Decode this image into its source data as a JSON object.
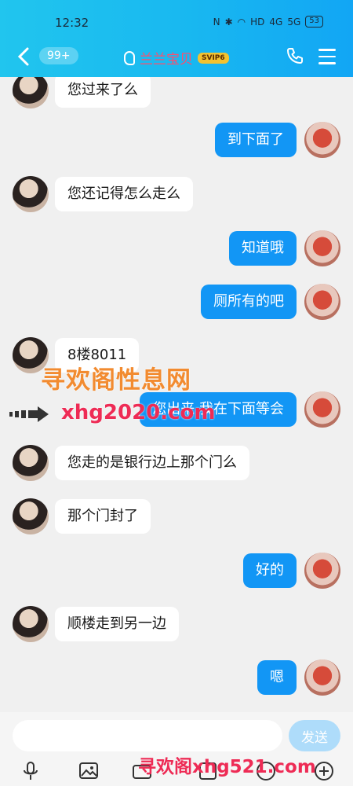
{
  "status": {
    "time": "12:32",
    "battery": "53",
    "signal1": "4G",
    "signal2": "5G",
    "hd": "HD"
  },
  "header": {
    "back_label": "<",
    "unread_badge": "99+",
    "contact_name": "兰兰宝贝",
    "vip_badge": "SVIP6"
  },
  "messages": [
    {
      "side": "left",
      "text": "您过来了么"
    },
    {
      "side": "right",
      "text": "到下面了"
    },
    {
      "side": "left",
      "text": "您还记得怎么走么"
    },
    {
      "side": "right",
      "text": "知道哦"
    },
    {
      "side": "right",
      "text": "厕所有的吧"
    },
    {
      "side": "left",
      "text": "8楼8011"
    },
    {
      "side": "right",
      "text": "您出来 我在下面等会"
    },
    {
      "side": "left",
      "text": "您走的是银行边上那个门么"
    },
    {
      "side": "left",
      "text": "那个门封了"
    },
    {
      "side": "right",
      "text": "好的"
    },
    {
      "side": "left",
      "text": "顺楼走到另一边"
    },
    {
      "side": "right",
      "text": "嗯"
    }
  ],
  "watermark": {
    "line1": "寻欢阁性息网",
    "line2": "xhg2020.com",
    "line3": "寻欢阁xhg521.com"
  },
  "composer": {
    "input_value": "",
    "send_label": "发送"
  },
  "colors": {
    "header_start": "#21c5ee",
    "header_end": "#12a6f4",
    "my_bubble": "#1296f5",
    "their_bubble": "#ffffff",
    "send_button": "#aedcfa"
  }
}
